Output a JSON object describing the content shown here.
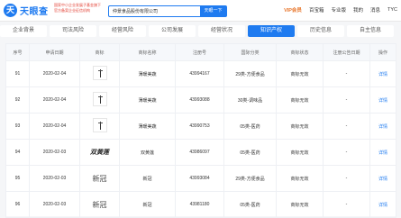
{
  "app": {
    "logo_text": "天眼查",
    "logo_letter": "天",
    "promo_line1": "国家中小企业发展子基金旗下",
    "promo_line2": "官方备案企业征信机构"
  },
  "search": {
    "value": "仲景食品股份有限公司",
    "button_label": "天眼一下"
  },
  "topnav": {
    "vip": "VIP会员",
    "items": [
      "百宝箱",
      "专业版",
      "我的",
      "消息",
      "TYC"
    ]
  },
  "tabs": [
    {
      "label": "企业背景",
      "badge": "",
      "active": false
    },
    {
      "label": "司法风险",
      "badge": "",
      "active": false
    },
    {
      "label": "经营风险",
      "badge": "",
      "active": false
    },
    {
      "label": "公司发展",
      "badge": "",
      "active": false
    },
    {
      "label": "经营状况",
      "badge": "",
      "active": false
    },
    {
      "label": "知识产权",
      "badge": "",
      "active": true
    },
    {
      "label": "历史信息",
      "badge": "",
      "active": false
    },
    {
      "label": "自主信息",
      "badge": "",
      "active": false
    }
  ],
  "table": {
    "headers": [
      "序号",
      "申请日期",
      "商标",
      "商标名称",
      "注册号",
      "国际分类",
      "商标状态",
      "注册公告日期",
      "操作"
    ],
    "rows": [
      {
        "idx": "91",
        "date": "2020-02-04",
        "mark": "img",
        "name": "薄暖美蔬",
        "reg": "43994167",
        "cls": "29类-方便食品",
        "status": "商标无效",
        "notice": "-",
        "op": "详情"
      },
      {
        "idx": "92",
        "date": "2020-02-04",
        "mark": "img",
        "name": "薄暖美蔬",
        "reg": "43993088",
        "cls": "30类-调味品",
        "status": "商标无效",
        "notice": "-",
        "op": "详情"
      },
      {
        "idx": "93",
        "date": "2020-02-04",
        "mark": "img",
        "name": "薄暖美蔬",
        "reg": "43990753",
        "cls": "05类-医药",
        "status": "商标无效",
        "notice": "-",
        "op": "详情"
      },
      {
        "idx": "94",
        "date": "2020-02-03",
        "mark": "calligraphy",
        "mark_text": "双黄莲",
        "name": "双黄莲",
        "reg": "43986097",
        "cls": "05类-医药",
        "status": "商标无效",
        "notice": "-",
        "op": "详情"
      },
      {
        "idx": "95",
        "date": "2020-02-03",
        "mark": "xinguan",
        "mark_text": "新冠",
        "name": "新冠",
        "reg": "43993084",
        "cls": "29类-方便食品",
        "status": "商标无效",
        "notice": "-",
        "op": "详情"
      },
      {
        "idx": "96",
        "date": "2020-02-03",
        "mark": "xinguan",
        "mark_text": "新冠",
        "name": "新冠",
        "reg": "43981180",
        "cls": "05类-医药",
        "status": "商标无效",
        "notice": "-",
        "op": "详情"
      }
    ]
  }
}
